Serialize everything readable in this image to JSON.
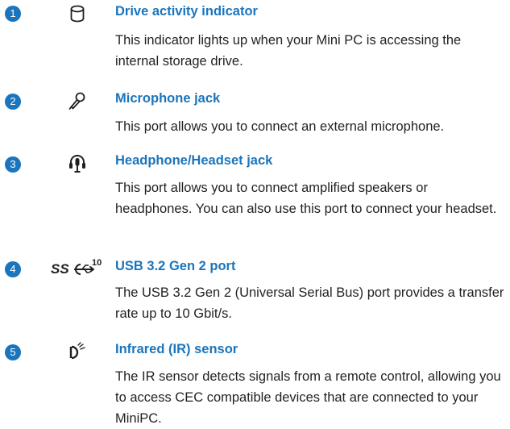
{
  "colors": {
    "accent": "#1b75bc",
    "text": "#231f20"
  },
  "items": [
    {
      "number": "1",
      "icon": "drive-activity-icon",
      "title": "Drive activity indicator",
      "description": "This indicator lights up when your Mini PC is accessing the internal storage drive."
    },
    {
      "number": "2",
      "icon": "microphone-icon",
      "title": "Microphone jack",
      "description": "This port allows you to connect an external microphone."
    },
    {
      "number": "3",
      "icon": "headphone-headset-icon",
      "title": "Headphone/Headset jack",
      "description": "This port allows you to connect amplified speakers or headphones. You can also use this port to connect your headset."
    },
    {
      "number": "4",
      "icon": "usb-superspeed-10-icon",
      "icon_text": "10",
      "title": "USB 3.2 Gen 2 port",
      "description": "The USB 3.2 Gen 2 (Universal Serial Bus) port provides a transfer rate up to 10 Gbit/s."
    },
    {
      "number": "5",
      "icon": "infrared-sensor-icon",
      "title": "Infrared (IR) sensor",
      "description": "The IR sensor detects signals from a remote control, allowing you to access CEC compatible devices that are connected to your MiniPC."
    }
  ]
}
